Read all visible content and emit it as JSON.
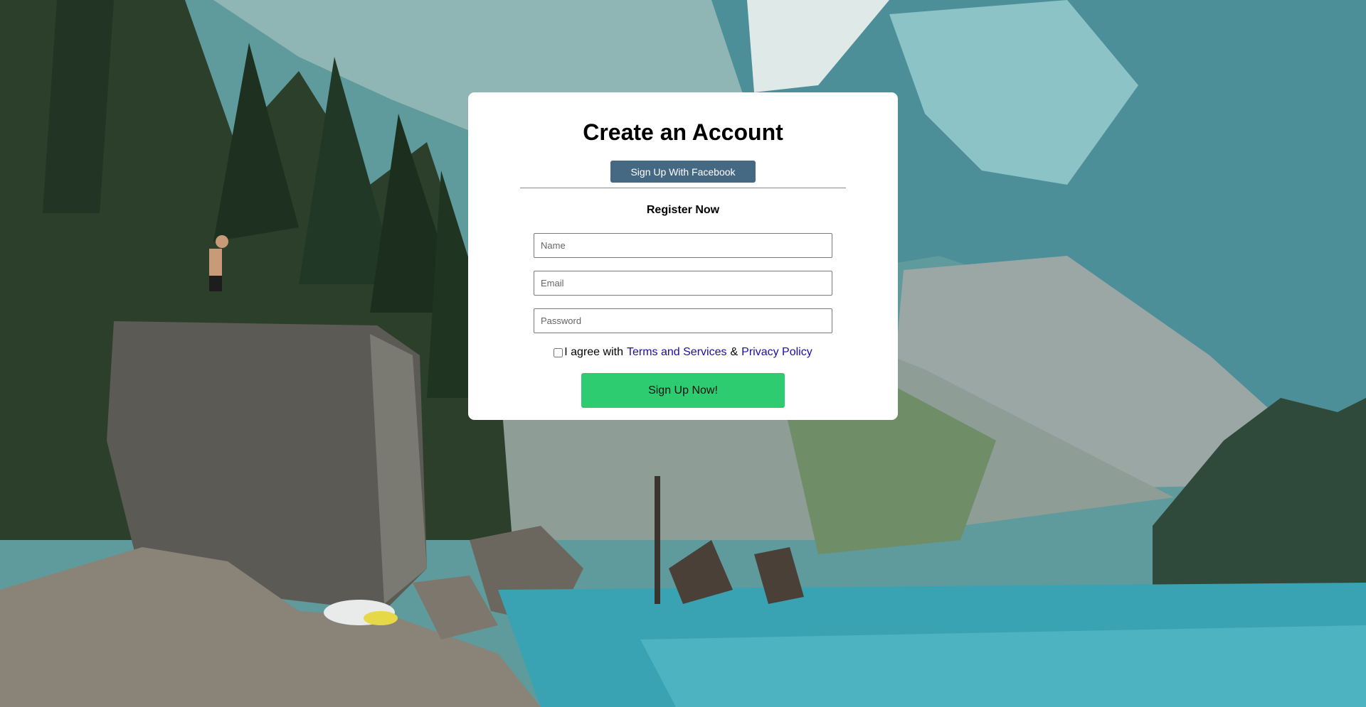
{
  "page": {
    "title": "Create an Account",
    "facebook_button": "Sign Up With Facebook",
    "subtitle": "Register Now"
  },
  "form": {
    "name_placeholder": "Name",
    "email_placeholder": "Email",
    "password_placeholder": "Password",
    "agree_prefix": "I agree with",
    "terms_link": "Terms and Services",
    "ampersand": "&",
    "privacy_link": "Privacy Policy",
    "submit_label": "Sign Up Now!"
  },
  "colors": {
    "facebook_button": "#456883",
    "submit_button": "#2ecc71",
    "link": "#1a0dab"
  },
  "background": {
    "icon": "mountain-lake-photo"
  }
}
